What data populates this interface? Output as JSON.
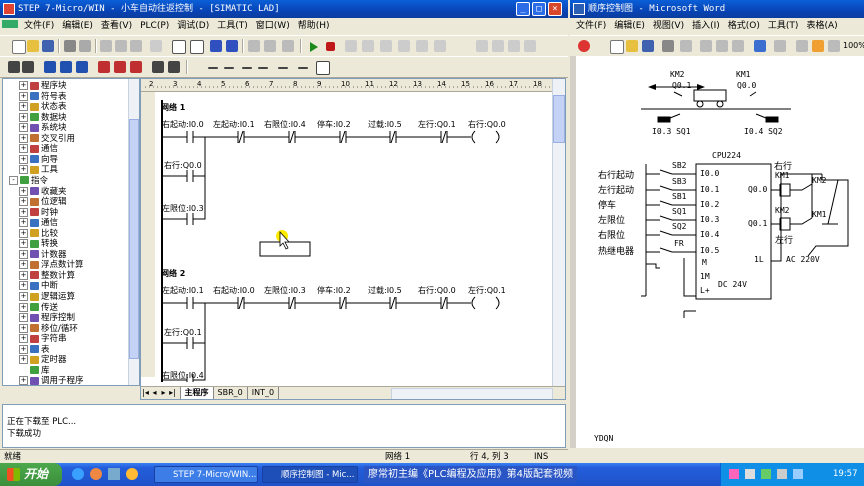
{
  "step7": {
    "title": "STEP 7-Micro/WIN - 小车自动往返控制 - [SIMATIC LAD]",
    "menu": [
      "文件(F)",
      "编辑(E)",
      "查看(V)",
      "PLC(P)",
      "调试(D)",
      "工具(T)",
      "窗口(W)",
      "帮助(H)"
    ],
    "tree": [
      {
        "label": "程序块",
        "box": "+",
        "indent": 1
      },
      {
        "label": "符号表",
        "box": "+",
        "indent": 1
      },
      {
        "label": "状态表",
        "box": "+",
        "indent": 1
      },
      {
        "label": "数据块",
        "box": "+",
        "indent": 1
      },
      {
        "label": "系统块",
        "box": "+",
        "indent": 1
      },
      {
        "label": "交叉引用",
        "box": "+",
        "indent": 1
      },
      {
        "label": "通信",
        "box": "+",
        "indent": 1
      },
      {
        "label": "向导",
        "box": "+",
        "indent": 1
      },
      {
        "label": "工具",
        "box": "+",
        "indent": 1
      },
      {
        "label": "指令",
        "box": "-",
        "indent": 0
      },
      {
        "label": "收藏夹",
        "box": "+",
        "indent": 1
      },
      {
        "label": "位逻辑",
        "box": "+",
        "indent": 1
      },
      {
        "label": "时钟",
        "box": "+",
        "indent": 1
      },
      {
        "label": "通信",
        "box": "+",
        "indent": 1
      },
      {
        "label": "比较",
        "box": "+",
        "indent": 1
      },
      {
        "label": "转换",
        "box": "+",
        "indent": 1
      },
      {
        "label": "计数器",
        "box": "+",
        "indent": 1
      },
      {
        "label": "浮点数计算",
        "box": "+",
        "indent": 1
      },
      {
        "label": "整数计算",
        "box": "+",
        "indent": 1
      },
      {
        "label": "中断",
        "box": "+",
        "indent": 1
      },
      {
        "label": "逻辑运算",
        "box": "+",
        "indent": 1
      },
      {
        "label": "传送",
        "box": "+",
        "indent": 1
      },
      {
        "label": "程序控制",
        "box": "+",
        "indent": 1
      },
      {
        "label": "移位/循环",
        "box": "+",
        "indent": 1
      },
      {
        "label": "字符串",
        "box": "+",
        "indent": 1
      },
      {
        "label": "表",
        "box": "+",
        "indent": 1
      },
      {
        "label": "定时器",
        "box": "+",
        "indent": 1
      },
      {
        "label": "库",
        "box": "",
        "indent": 1
      },
      {
        "label": "调用子程序",
        "box": "+",
        "indent": 1
      }
    ],
    "ruler": [
      "2",
      "3",
      "4",
      "5",
      "6",
      "7",
      "8",
      "9",
      "10",
      "11",
      "12",
      "13",
      "14",
      "15",
      "16",
      "17",
      "18"
    ],
    "network1": {
      "title": "网络 1",
      "contacts": [
        "右起动:I0.0",
        "左起动:I0.1",
        "右限位:I0.4",
        "停车:I0.2",
        "过载:I0.5",
        "左行:Q0.1"
      ],
      "coil": "右行:Q0.0",
      "branch": [
        "右行:Q0.0",
        "左限位:I0.3"
      ]
    },
    "network2": {
      "title": "网络 2",
      "contacts": [
        "左起动:I0.1",
        "右起动:I0.0",
        "左限位:I0.3",
        "停车:I0.2",
        "过载:I0.5",
        "右行:Q0.0"
      ],
      "coil": "左行:Q0.1",
      "branch": [
        "左行:Q0.1",
        "右限位:I0.4"
      ]
    },
    "tabs": [
      "主程序",
      "SBR_0",
      "INT_0"
    ],
    "output_lines": [
      "正在下载至 PLC...",
      "下载成功"
    ],
    "status": {
      "left": "就绪",
      "network": "网络 1",
      "position": "行 4, 列 3",
      "mode": "INS"
    }
  },
  "word": {
    "title": "顺序控制图 - Microsoft Word",
    "menu": [
      "文件(F)",
      "编辑(E)",
      "视图(V)",
      "插入(I)",
      "格式(O)",
      "工具(T)",
      "表格(A)"
    ],
    "zoom": "100%",
    "diagram": {
      "km2_top": "KM2",
      "q01": "Q0.1",
      "km1_top": "KM1",
      "q00": "Q0.0",
      "left_sensor": "I0.3 SQ1",
      "right_sensor": "I0.4 SQ2",
      "cpu": "CPU224",
      "input_labels": [
        "右行起动",
        "左行起动",
        "停车",
        "左限位",
        "右限位",
        "热继电器"
      ],
      "switch_names": [
        "SB2",
        "SB3",
        "SB1",
        "SQ1",
        "SQ2",
        "FR"
      ],
      "cpu_inputs": [
        "I0.0",
        "I0.1",
        "I0.2",
        "I0.3",
        "I0.4",
        "I0.5",
        "M",
        "1M",
        "L+"
      ],
      "cpu_outputs": [
        "Q0.0",
        "Q0.1",
        "1L"
      ],
      "dc": "DC 24V",
      "out_right_label": "右行",
      "out_left_label": "左行",
      "km1": "KM1",
      "km2": "KM2",
      "km2b": "KM2",
      "km1b": "KM1",
      "ac": "AC 220V"
    },
    "footer": "YDQN"
  },
  "taskbar": {
    "start": "开始",
    "items": [
      "STEP 7-Micro/WIN...",
      "顺序控制图 - Mic..."
    ],
    "banner": "廖常初主编《PLC编程及应用》第4版配套视频",
    "clock": "19:57"
  }
}
